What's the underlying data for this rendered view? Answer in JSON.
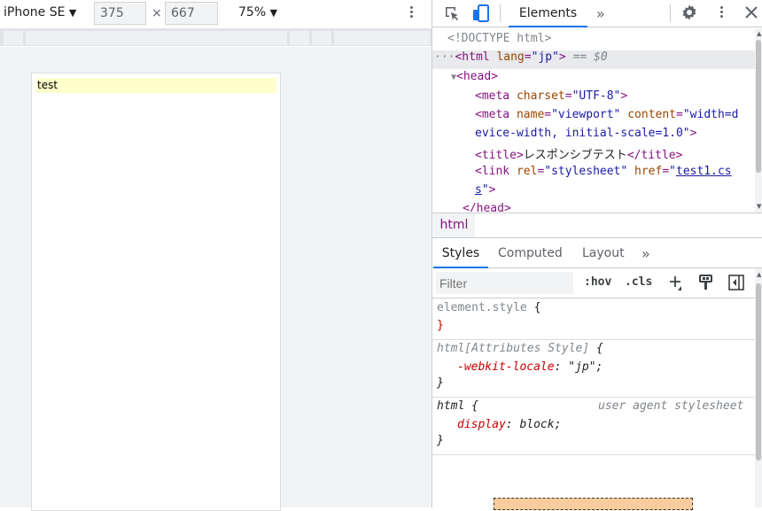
{
  "device_toolbar": {
    "device": "iPhone SE",
    "width": "375",
    "height": "667",
    "times_sign": "×",
    "zoom": "75%"
  },
  "page": {
    "test_text": "test"
  },
  "devtools": {
    "tabs": {
      "elements": "Elements",
      "more": "»"
    },
    "tree": {
      "doctype": "<!DOCTYPE html>",
      "html_open_tag": "<html",
      "html_lang_attr": "lang",
      "html_lang_val": "\"jp\"",
      "html_close_bracket": ">",
      "selected_marker": "== $0",
      "head_open": "<head>",
      "meta1_tag": "<meta",
      "meta1_attr": "charset",
      "meta1_val": "\"UTF-8\"",
      "meta2_tag": "<meta",
      "meta2_name_attr": "name",
      "meta2_name_val": "\"viewport\"",
      "meta2_content_attr": "content",
      "meta2_content_val_a": "\"width=d",
      "meta2_content_val_b": "evice-width, initial-scale=1.0\"",
      "title_open": "<title>",
      "title_text": "レスポンシブテスト",
      "title_close": "</title>",
      "link_tag": "<link",
      "link_rel_attr": "rel",
      "link_rel_val": "\"stylesheet\"",
      "link_href_attr": "href",
      "link_href_a": "test1.cs",
      "link_href_b": "s",
      "head_close": "</head>"
    },
    "breadcrumb": "html",
    "styles_tabs": {
      "styles": "Styles",
      "computed": "Computed",
      "layout": "Layout",
      "more": "»"
    },
    "filter": {
      "placeholder": "Filter",
      "hov": ":hov",
      "cls": ".cls"
    },
    "rules": {
      "r1_selector": "element.style",
      "r2_selector": "html[Attributes Style]",
      "r2_prop": "-webkit-locale",
      "r2_val": "\"jp\"",
      "r3_selector": "html",
      "r3_source": "user agent stylesheet",
      "r3_prop": "display",
      "r3_val": "block"
    }
  },
  "colors": {
    "accent": "#1a73e8",
    "tag": "#881280",
    "attr": "#994500",
    "value": "#1a1aa6"
  }
}
